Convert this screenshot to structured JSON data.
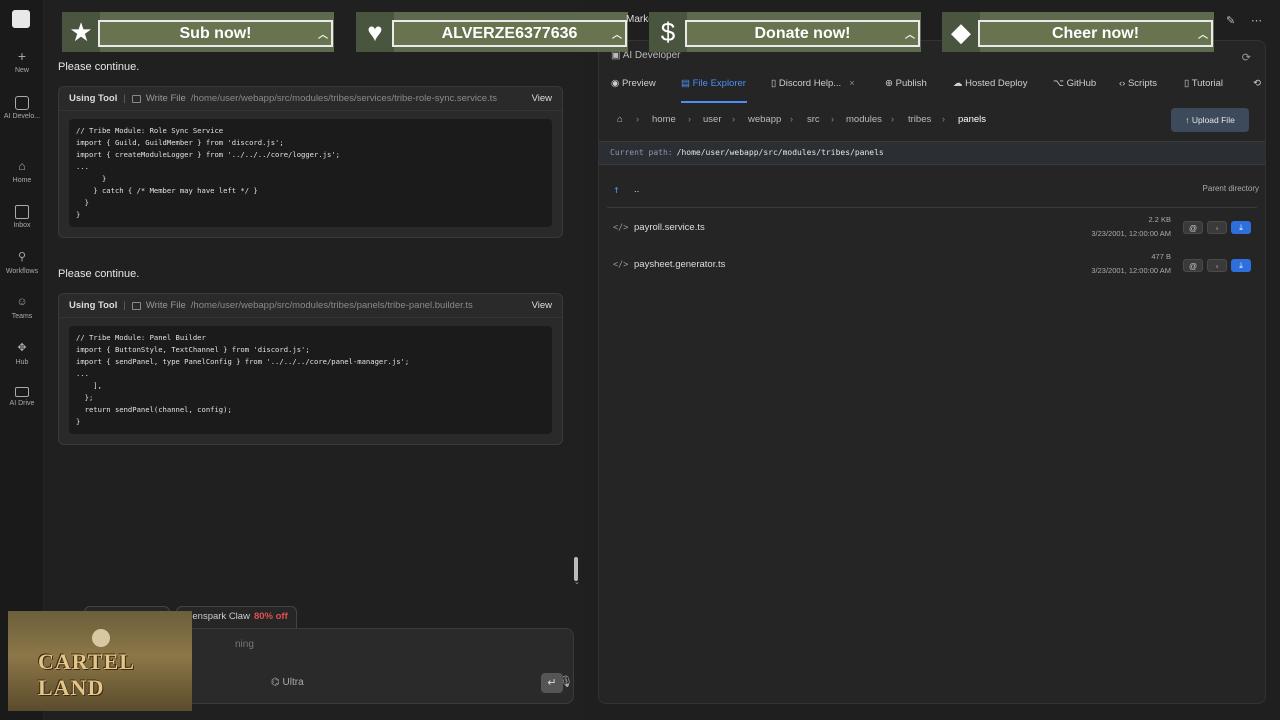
{
  "rail": {
    "items": [
      {
        "label": "New",
        "icon": "plus-icon"
      },
      {
        "label": "AI Develo...",
        "icon": "ai-developer-icon"
      },
      {
        "label": "Home",
        "icon": "home-icon"
      },
      {
        "label": "Inbox",
        "icon": "inbox-icon"
      },
      {
        "label": "Workflows",
        "icon": "workflows-icon"
      },
      {
        "label": "Teams",
        "icon": "teams-icon"
      },
      {
        "label": "Hub",
        "icon": "hub-icon"
      },
      {
        "label": "AI Drive",
        "icon": "drive-icon"
      }
    ]
  },
  "chat": {
    "messages": [
      {
        "prompt": "Please continue.",
        "tool_label": "Using Tool",
        "tool_action": "Write File",
        "tool_path": "/home/user/webapp/src/modules/tribes/services/tribe-role-sync.service.ts",
        "view_label": "View",
        "code": "// Tribe Module: Role Sync Service\nimport { Guild, GuildMember } from 'discord.js';\nimport { createModuleLogger } from '../../../core/logger.js';\n...\n      }\n    } catch { /* Member may have left */ }\n  }\n}"
      },
      {
        "prompt": "Please continue.",
        "tool_label": "Using Tool",
        "tool_action": "Write File",
        "tool_path": "/home/user/webapp/src/modules/tribes/panels/tribe-panel.builder.ts",
        "view_label": "View",
        "code": "// Tribe Module: Panel Builder\nimport { ButtonStyle, TextChannel } from 'discord.js';\nimport { sendPanel, type PanelConfig } from '../../../core/panel-manager.js';\n...\n    ],\n  };\n  return sendPanel(channel, config);\n}"
      }
    ],
    "composer": {
      "tab_name": "Genspark Claw",
      "tab_badge": "80% off",
      "placeholder": "ning",
      "ultra_label": "Ultra"
    }
  },
  "panel": {
    "title": "AI Developer",
    "tabs": [
      {
        "label": "Preview",
        "icon": "eye-icon"
      },
      {
        "label": "File Explorer",
        "icon": "folder-icon",
        "active": true
      },
      {
        "label": "Discord Help...",
        "icon": "file-icon",
        "closable": "×"
      },
      {
        "label": "Publish",
        "icon": "globe-icon"
      },
      {
        "label": "Hosted Deploy",
        "icon": "cloud-icon"
      },
      {
        "label": "GitHub",
        "icon": "github-icon"
      },
      {
        "label": "Scripts",
        "icon": "code-icon"
      },
      {
        "label": "Tutorial",
        "icon": "book-icon"
      }
    ],
    "breadcrumbs": [
      "home",
      "user",
      "webapp",
      "src",
      "modules",
      "tribes",
      "panels"
    ],
    "upload_label": "Upload File",
    "current_path_label": "Current path:",
    "current_path": "/home/user/webapp/src/modules/tribes/panels",
    "parent": {
      "name": "..",
      "label": "Parent directory"
    },
    "files": [
      {
        "name": "payroll.service.ts",
        "size": "2.2 KB",
        "date": "3/23/2001, 12:00:00 AM"
      },
      {
        "name": "paysheet.generator.ts",
        "size": "477 B",
        "date": "3/23/2001, 12:00:00 AM"
      }
    ]
  },
  "overlay": {
    "banners": [
      {
        "label": "Sub now!",
        "icon": "★"
      },
      {
        "label": "ALVERZE6377636",
        "icon": "♥"
      },
      {
        "label": "Donate now!",
        "icon": "$"
      },
      {
        "label": "Cheer now!",
        "icon": "◆"
      }
    ],
    "marker_text": "Marke",
    "webcam_logo": "CARTEL LAND"
  },
  "colors": {
    "accent": "#4d8ff5",
    "download": "#2f6fdd",
    "badge": "#e05050",
    "banner": "#67744f"
  }
}
